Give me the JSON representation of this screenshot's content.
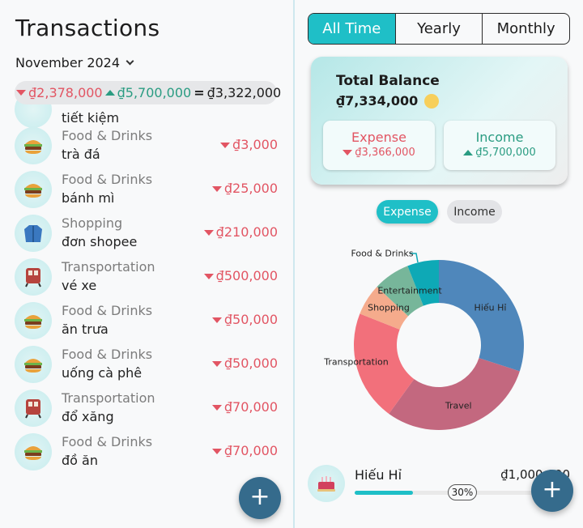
{
  "header": {
    "title": "Transactions",
    "month": "November 2024"
  },
  "summary": {
    "expense": "₫2,378,000",
    "income": "₫5,700,000",
    "equals": "=",
    "net": "₫3,322,000"
  },
  "partial_row_note": "tiết kiệm",
  "transactions": [
    {
      "category": "Food & Drinks",
      "note": "trà đá",
      "amount": "₫3,000",
      "icon": "burger-icon"
    },
    {
      "category": "Food & Drinks",
      "note": "bánh mì",
      "amount": "₫25,000",
      "icon": "burger-icon"
    },
    {
      "category": "Shopping",
      "note": "đơn shopee",
      "amount": "₫210,000",
      "icon": "jacket-icon"
    },
    {
      "category": "Transportation",
      "note": "vé xe",
      "amount": "₫500,000",
      "icon": "train-icon"
    },
    {
      "category": "Food & Drinks",
      "note": "ăn trưa",
      "amount": "₫50,000",
      "icon": "burger-icon"
    },
    {
      "category": "Food & Drinks",
      "note": "uống cà phê",
      "amount": "₫50,000",
      "icon": "burger-icon"
    },
    {
      "category": "Transportation",
      "note": "đổ xăng",
      "amount": "₫70,000",
      "icon": "train-icon"
    },
    {
      "category": "Food & Drinks",
      "note": "đồ ăn",
      "amount": "₫70,000",
      "icon": "burger-icon"
    }
  ],
  "fab": {
    "label": "+"
  },
  "period_tabs": [
    "All Time",
    "Yearly",
    "Monthly"
  ],
  "balance": {
    "title": "Total Balance",
    "value": "₫7,334,000",
    "expense_label": "Expense",
    "expense_value": "₫3,366,000",
    "income_label": "Income",
    "income_value": "₫5,700,000"
  },
  "toggle": {
    "expense": "Expense",
    "income": "Income"
  },
  "chart_data": {
    "type": "pie",
    "donut": true,
    "categories": [
      "Hiếu Hỉ",
      "Travel",
      "Transportation",
      "Shopping",
      "Entertainment",
      "Food & Drinks"
    ],
    "values": [
      30,
      30,
      21,
      6,
      7,
      6
    ],
    "colors": [
      "#4f87bb",
      "#c3687f",
      "#f2707b",
      "#f5ab8c",
      "#77b69a",
      "#0ea9b6"
    ]
  },
  "top_category": {
    "name": "Hiếu Hỉ",
    "amount": "₫1,000,000",
    "percent_label": "30%",
    "percent": 30,
    "icon": "cake-icon"
  },
  "colors": {
    "accent": "#1fbfc7",
    "expense": "#e25563",
    "income": "#2a9c82",
    "fab": "#356b8c"
  }
}
